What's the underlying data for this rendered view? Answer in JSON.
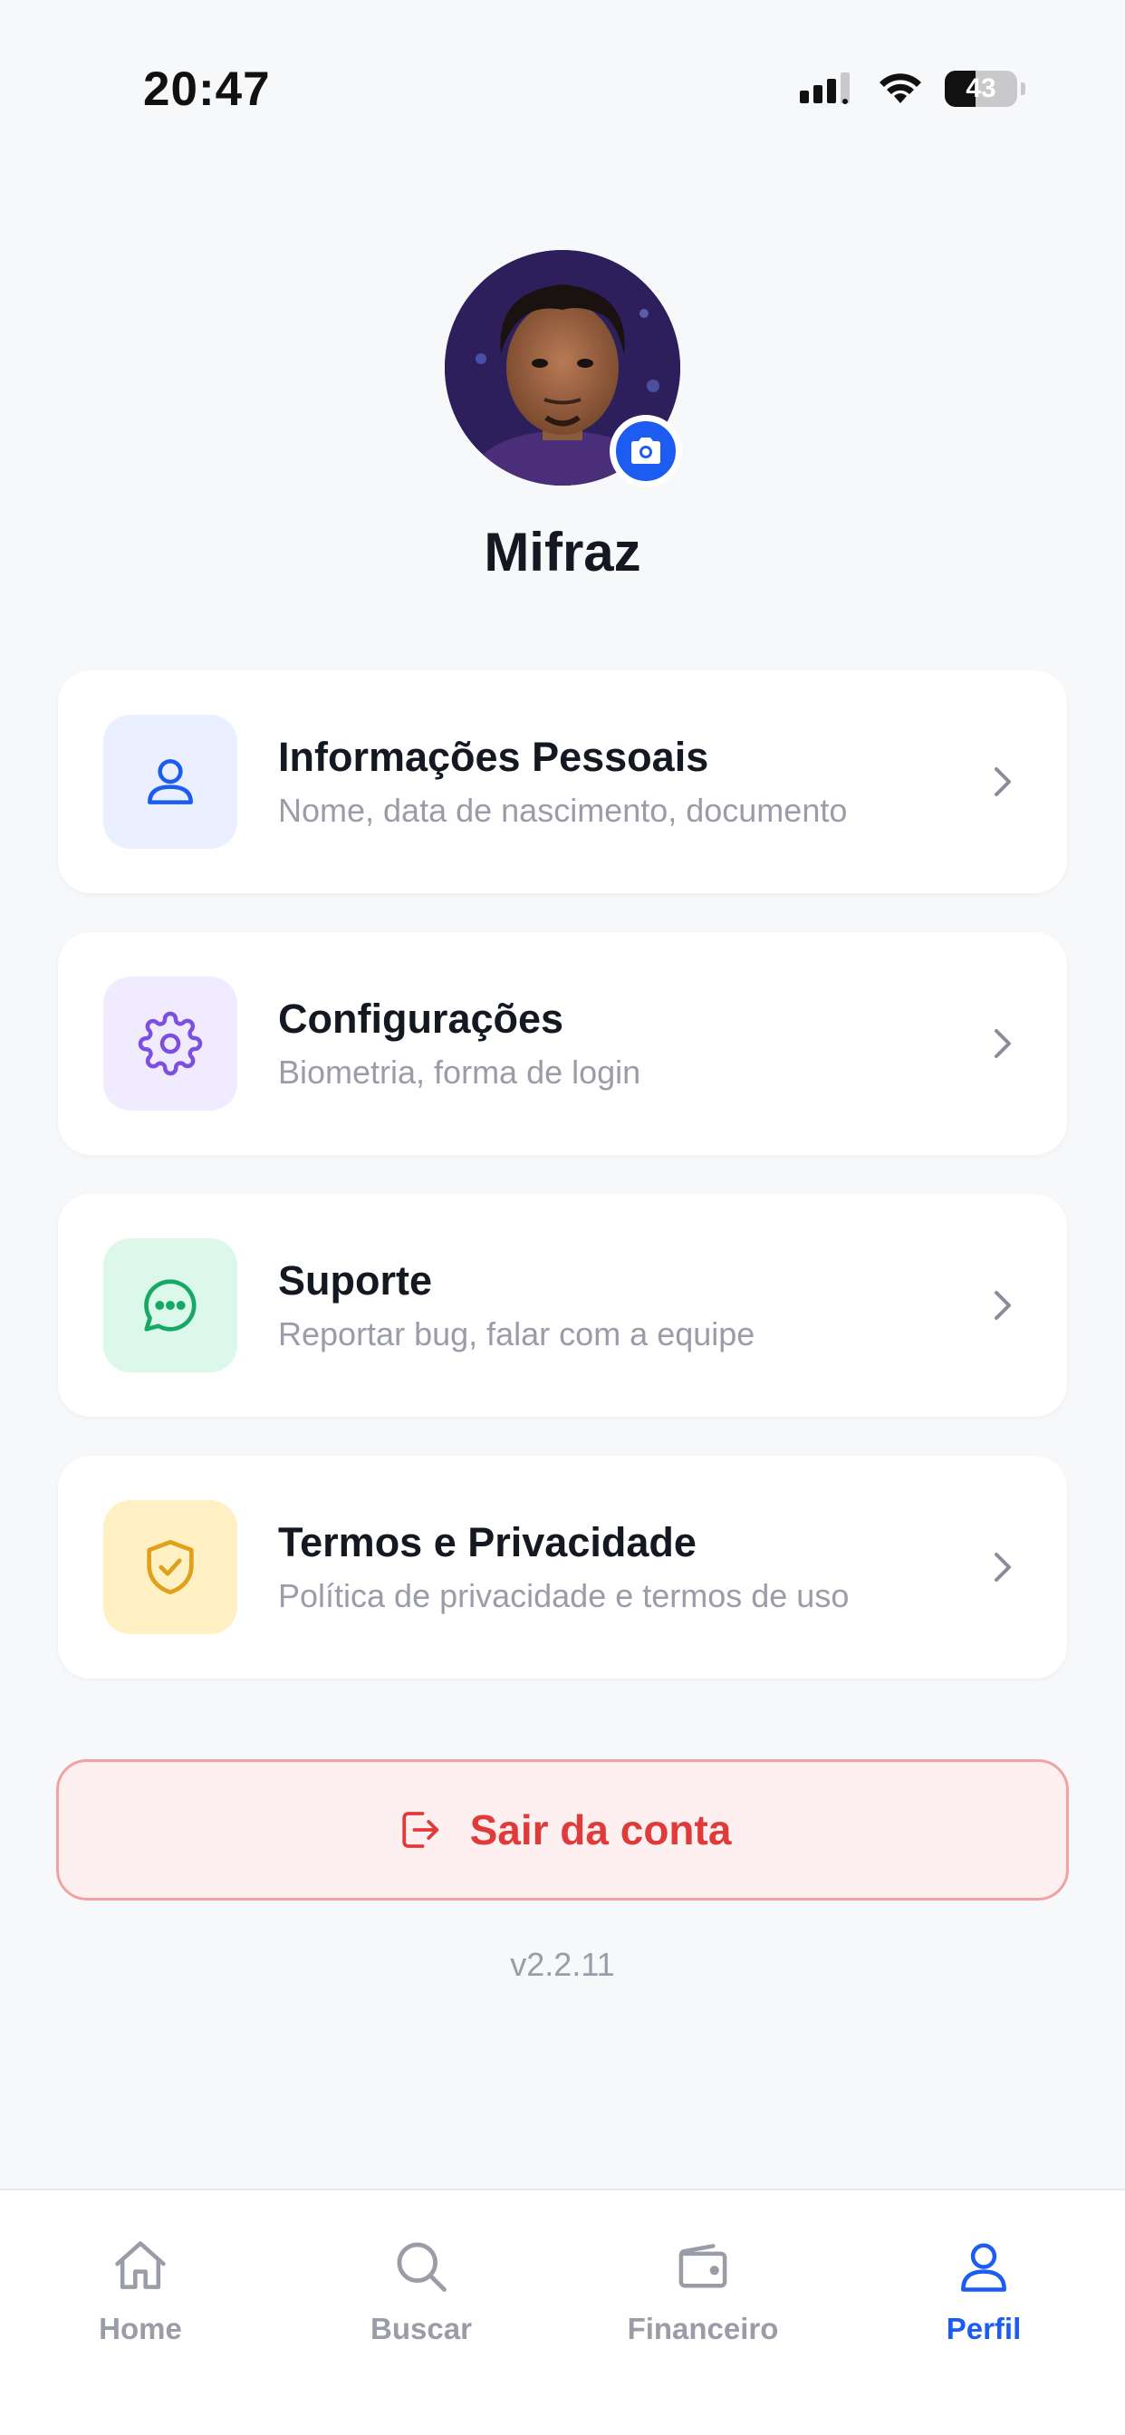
{
  "status_bar": {
    "time": "20:47",
    "battery_percent": "43"
  },
  "profile": {
    "name": "Mifraz",
    "avatar_icon": "avatar-photo",
    "camera_icon": "camera-icon"
  },
  "menu": {
    "items": [
      {
        "title": "Informações Pessoais",
        "subtitle": "Nome, data de nascimento, documento",
        "icon": "user-icon",
        "icon_color": "#1d5cf0",
        "icon_bg": "#eaf0ff"
      },
      {
        "title": "Configurações",
        "subtitle": "Biometria, forma de login",
        "icon": "gear-icon",
        "icon_color": "#7c4fe0",
        "icon_bg": "#f1ebff"
      },
      {
        "title": "Suporte",
        "subtitle": "Reportar bug, falar com a equipe",
        "icon": "chat-icon",
        "icon_color": "#17a866",
        "icon_bg": "#dcf8ea"
      },
      {
        "title": "Termos e Privacidade",
        "subtitle": "Política de privacidade e termos de uso",
        "icon": "shield-check-icon",
        "icon_color": "#e0a019",
        "icon_bg": "#fff1c4"
      }
    ]
  },
  "logout": {
    "label": "Sair da conta",
    "color": "#e03b3b"
  },
  "version": "v2.2.11",
  "tab_bar": {
    "active_color": "#1d5cf0",
    "inactive_color": "#9a9ca8",
    "tabs": [
      {
        "label": "Home",
        "icon": "home-icon",
        "active": false
      },
      {
        "label": "Buscar",
        "icon": "search-icon",
        "active": false
      },
      {
        "label": "Financeiro",
        "icon": "wallet-icon",
        "active": false
      },
      {
        "label": "Perfil",
        "icon": "user-icon",
        "active": true
      }
    ]
  }
}
